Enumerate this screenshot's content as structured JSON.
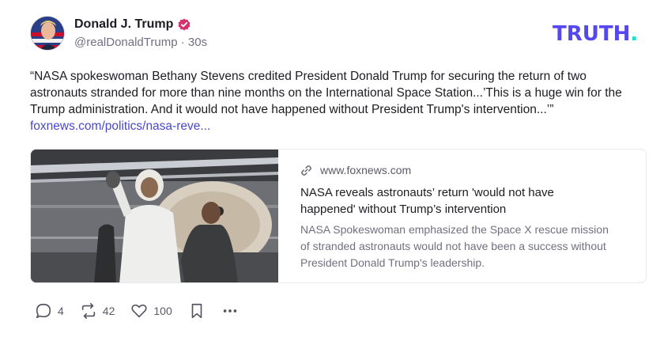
{
  "author": {
    "display_name": "Donald J. Trump",
    "handle": "@realDonaldTrump",
    "time": "30s"
  },
  "brand": {
    "logo_text": "TRUTH",
    "logo_dot": ".",
    "logo_color": "#5448ee",
    "dot_color": "#17e3c2"
  },
  "post": {
    "text": "“NASA spokeswoman Bethany Stevens credited President Donald Trump for securing the return of two astronauts stranded for more than nine months on the International Space Station...’This is a huge win for the Trump administration. And it would not have happened without President Trump's intervention...’”",
    "link_text": "foxnews.com/politics/nasa-reve..."
  },
  "link_card": {
    "domain": "www.foxnews.com",
    "title": "NASA reveals astronauts’ return 'would not have happened' without Trump’s intervention",
    "description": "NASA Spokeswoman emphasized the Space X rescue mission of stranded astronauts would not have been a success without President Donald Trump's leadership."
  },
  "actions": {
    "replies": "4",
    "retruths": "42",
    "likes": "100"
  },
  "icons": {
    "verified": "verified-badge-icon",
    "link": "link-icon",
    "reply": "comment-icon",
    "retruth": "repost-icon",
    "like": "heart-icon",
    "bookmark": "bookmark-icon",
    "more": "more-icon"
  }
}
